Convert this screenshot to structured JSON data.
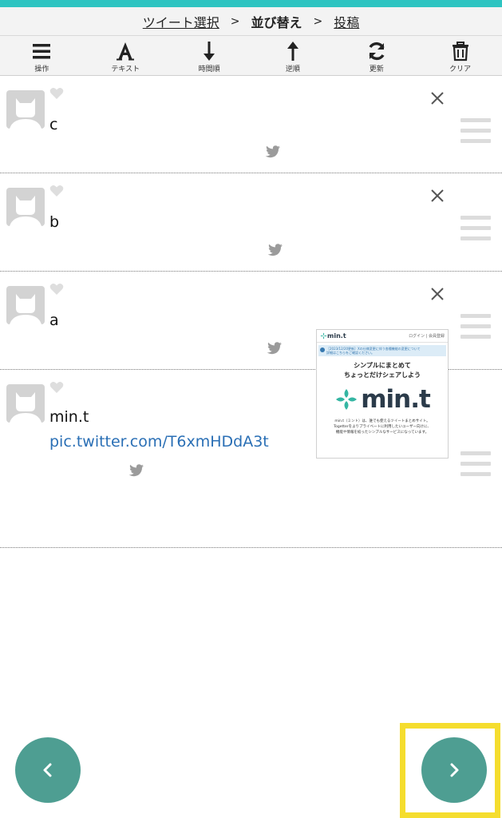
{
  "breadcrumb": {
    "step1": "ツイート選択",
    "step2": "並び替え",
    "step3": "投稿",
    "separator": ">"
  },
  "toolbar": {
    "items": [
      {
        "label": "操作",
        "icon": "menu-icon"
      },
      {
        "label": "テキスト",
        "icon": "text-icon"
      },
      {
        "label": "時間順",
        "icon": "arrow-down-icon"
      },
      {
        "label": "逆順",
        "icon": "arrow-up-icon"
      },
      {
        "label": "更新",
        "icon": "refresh-icon"
      },
      {
        "label": "クリア",
        "icon": "trash-icon"
      }
    ]
  },
  "tweets": [
    {
      "text": "c"
    },
    {
      "text": "b"
    },
    {
      "text": "a"
    },
    {
      "text": "min.t",
      "link": "pic.twitter.com/T6xmHDdA3t"
    }
  ],
  "thumbnail": {
    "site_logo": "min.t",
    "login_text": "ログイン | 会員登録",
    "notice_line1": "［2023/12/20更新］Xの仕様変更に伴う各種機能の変更について",
    "notice_line2": "詳細はこちらをご確認ください。",
    "headline_line1": "シンプルにまとめて",
    "headline_line2": "ちょっとだけシェアしよう",
    "brand": "min.t",
    "desc_line1": "min.t（ミント）は、誰でも使えるツイートまとめサイト。",
    "desc_line2": "Togetterをよりプライベートに利用したいユーザー向けに、",
    "desc_line3": "機能や情報を絞ったシンプルなサービスになっています。"
  },
  "colors": {
    "accent_top": "#2ec4c1",
    "nav_button": "#4e9e92",
    "highlight": "#f5dd2e",
    "link": "#2a6fb5"
  },
  "navigation": {
    "prev_icon": "chevron-left-icon",
    "next_icon": "chevron-right-icon"
  }
}
